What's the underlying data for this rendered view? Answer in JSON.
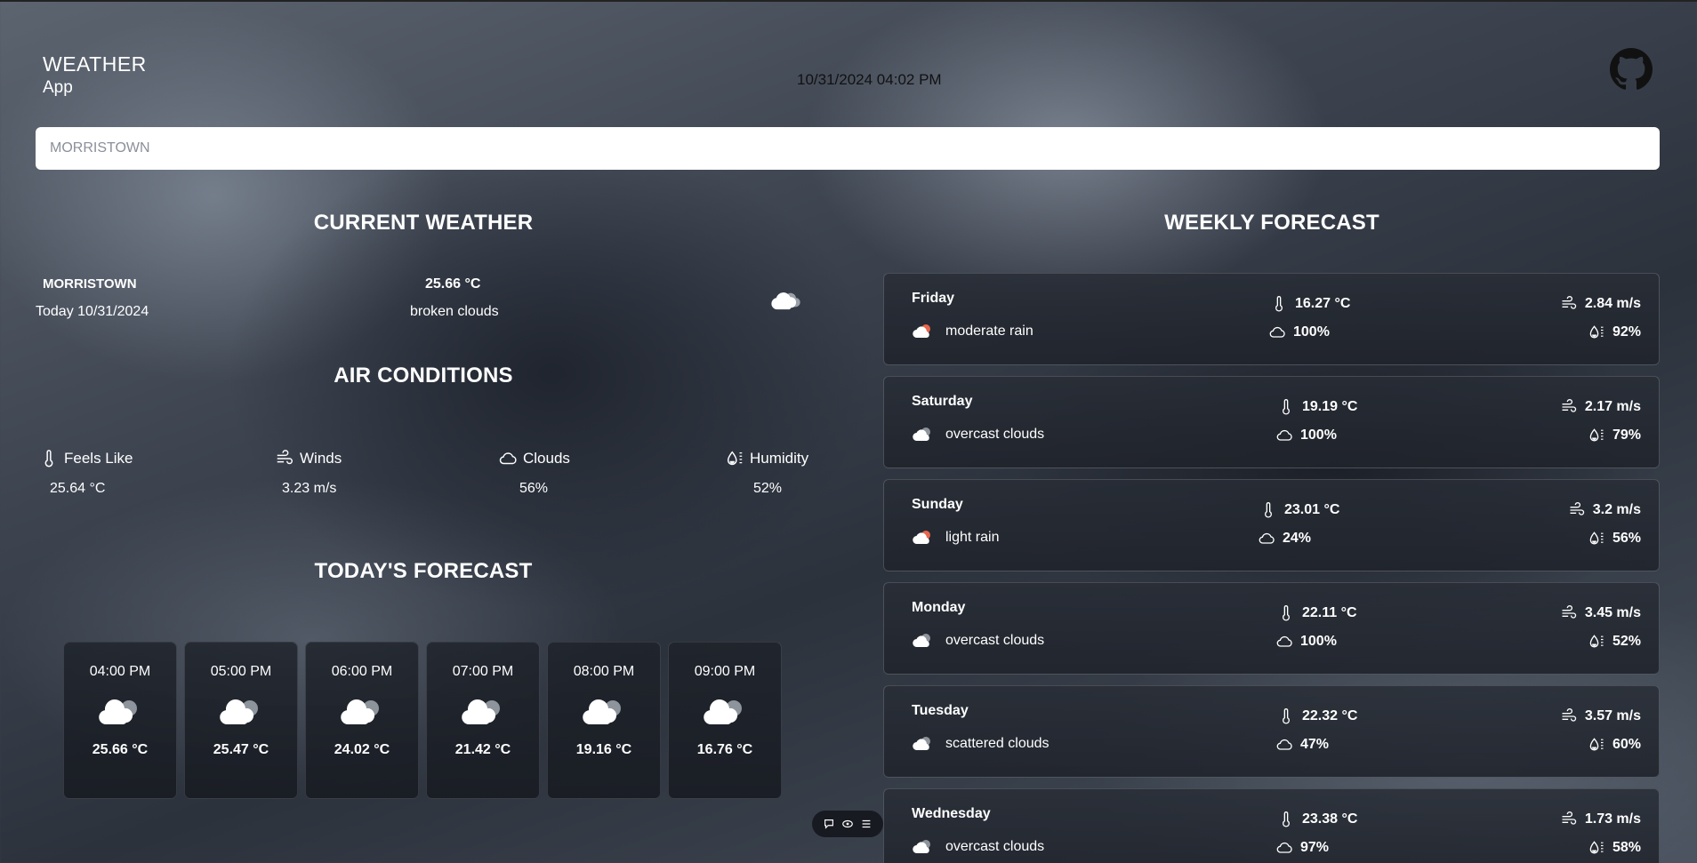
{
  "app": {
    "title_line1": "WEATHER",
    "title_line2": "App",
    "datetime": "10/31/2024 04:02 PM"
  },
  "search": {
    "value": "MORRISTOWN",
    "placeholder": "MORRISTOWN"
  },
  "sections": {
    "current": "CURRENT WEATHER",
    "air": "AIR CONDITIONS",
    "today": "TODAY'S FORECAST",
    "weekly": "WEEKLY FORECAST"
  },
  "current": {
    "city": "MORRISTOWN",
    "date": "Today 10/31/2024",
    "temp": "25.66 °C",
    "desc": "broken clouds",
    "icon": "broken-clouds-icon"
  },
  "air": [
    {
      "label": "Feels Like",
      "value": "25.64 °C",
      "icon": "thermometer-icon"
    },
    {
      "label": "Winds",
      "value": "3.23 m/s",
      "icon": "wind-icon"
    },
    {
      "label": "Clouds",
      "value": "56%",
      "icon": "cloud-icon"
    },
    {
      "label": "Humidity",
      "value": "52%",
      "icon": "humidity-icon"
    }
  ],
  "hourly": [
    {
      "time": "04:00 PM",
      "temp": "25.66 °C",
      "icon": "broken-clouds-icon"
    },
    {
      "time": "05:00 PM",
      "temp": "25.47 °C",
      "icon": "broken-clouds-icon"
    },
    {
      "time": "06:00 PM",
      "temp": "24.02 °C",
      "icon": "broken-clouds-icon"
    },
    {
      "time": "07:00 PM",
      "temp": "21.42 °C",
      "icon": "broken-clouds-icon"
    },
    {
      "time": "08:00 PM",
      "temp": "19.16 °C",
      "icon": "broken-clouds-icon"
    },
    {
      "time": "09:00 PM",
      "temp": "16.76 °C",
      "icon": "broken-clouds-icon"
    }
  ],
  "weekly": [
    {
      "day": "Friday",
      "desc": "moderate rain",
      "temp": "16.27 °C",
      "clouds": "100%",
      "wind": "2.84 m/s",
      "humidity": "92%",
      "icon": "rain-icon"
    },
    {
      "day": "Saturday",
      "desc": "overcast clouds",
      "temp": "19.19 °C",
      "clouds": "100%",
      "wind": "2.17 m/s",
      "humidity": "79%",
      "icon": "cloud-icon"
    },
    {
      "day": "Sunday",
      "desc": "light rain",
      "temp": "23.01 °C",
      "clouds": "24%",
      "wind": "3.2 m/s",
      "humidity": "56%",
      "icon": "rain-icon"
    },
    {
      "day": "Monday",
      "desc": "overcast clouds",
      "temp": "22.11 °C",
      "clouds": "100%",
      "wind": "3.45 m/s",
      "humidity": "52%",
      "icon": "cloud-icon"
    },
    {
      "day": "Tuesday",
      "desc": "scattered clouds",
      "temp": "22.32 °C",
      "clouds": "47%",
      "wind": "3.57 m/s",
      "humidity": "60%",
      "icon": "cloud-icon"
    },
    {
      "day": "Wednesday",
      "desc": "overcast clouds",
      "temp": "23.38 °C",
      "clouds": "97%",
      "wind": "1.73 m/s",
      "humidity": "58%",
      "icon": "cloud-icon"
    }
  ],
  "toolbar": {
    "icons": [
      "comment-icon",
      "eye-icon",
      "menu-icon"
    ]
  }
}
